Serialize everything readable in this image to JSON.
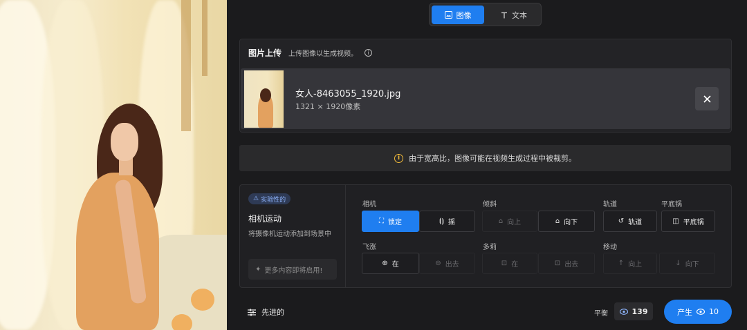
{
  "mode_toggle": {
    "image_label": "图像",
    "text_label": "文本"
  },
  "upload": {
    "title": "图片上传",
    "subtitle": "上传图像以生成视频。",
    "file_name": "女人-8463055_1920.jpg",
    "file_dims": "1321 × 1920像素"
  },
  "notice": {
    "text": "由于宽高比，图像可能在视频生成过程中被裁剪。"
  },
  "camera": {
    "badge": "实验性的",
    "title": "相机运动",
    "description": "将摄像机运动添加到场景中",
    "coming_soon": "更多内容即将启用!",
    "groups": {
      "camera": "相机",
      "tilt": "倾斜",
      "orbit": "轨道",
      "pan": "平底锅",
      "zoom": "飞涨",
      "dolly": "多莉",
      "move": "移动"
    },
    "options": {
      "lock": "锁定",
      "shake": "摇",
      "tilt_up": "向上",
      "tilt_down": "向下",
      "orbit": "轨道",
      "pan": "平底锅",
      "zoom_in": "在",
      "zoom_out": "出去",
      "dolly_in": "在",
      "dolly_out": "出去",
      "move_up": "向上",
      "move_down": "向下"
    }
  },
  "footer": {
    "advanced": "先进的",
    "balance_label": "平衡",
    "balance_value": "139",
    "generate_label": "产生",
    "generate_cost": "10"
  },
  "colors": {
    "accent": "#1f7ef0",
    "warning": "#f0b93a",
    "panel_bg": "#1b1b1d"
  }
}
